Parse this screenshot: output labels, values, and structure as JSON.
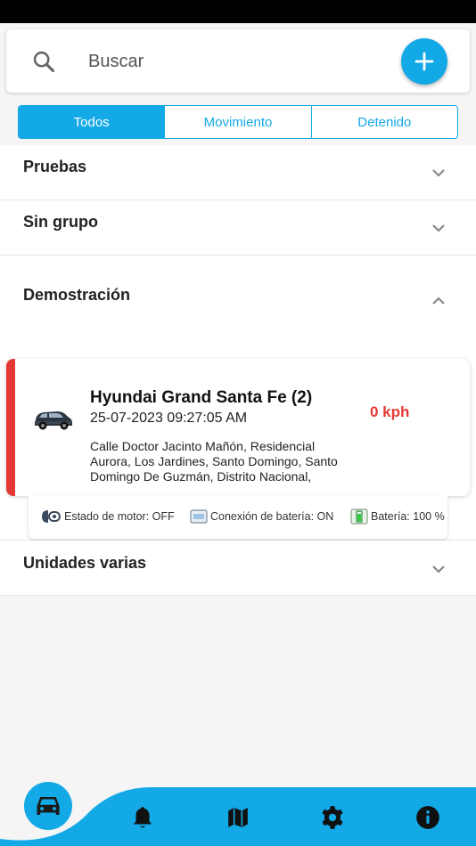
{
  "search": {
    "placeholder": "Buscar"
  },
  "tabs": [
    {
      "label": "Todos",
      "active": true
    },
    {
      "label": "Movimiento",
      "active": false
    },
    {
      "label": "Detenido",
      "active": false
    }
  ],
  "groups": [
    {
      "title": "Pruebas",
      "expanded": false
    },
    {
      "title": "Sin grupo",
      "expanded": false
    },
    {
      "title": "Demostración",
      "expanded": true
    },
    {
      "title": "Unidades varias",
      "expanded": false
    }
  ],
  "vehicle": {
    "name": "Hyundai Grand Santa Fe (2)",
    "datetime": "25-07-2023 09:27:05 AM",
    "speed": "0 kph",
    "address": "Calle Doctor Jacinto Mañón, Residencial Aurora, Los Jardines, Santo Domingo, Santo Domingo De Guzmán, Distrito Nacional,",
    "status_color": "#e53935"
  },
  "vehicle_info": {
    "engine": "Estado de motor: OFF",
    "battery_connection": "Conexión de batería: ON",
    "battery": "Batería: 100 %"
  },
  "bottom_nav": [
    {
      "icon": "car-icon",
      "active": true
    },
    {
      "icon": "bell-icon",
      "active": false
    },
    {
      "icon": "map-icon",
      "active": false
    },
    {
      "icon": "gear-icon",
      "active": false
    },
    {
      "icon": "info-icon",
      "active": false
    }
  ],
  "colors": {
    "accent": "#13a9e6",
    "alert": "#e53935",
    "background": "#f5f5f5"
  }
}
